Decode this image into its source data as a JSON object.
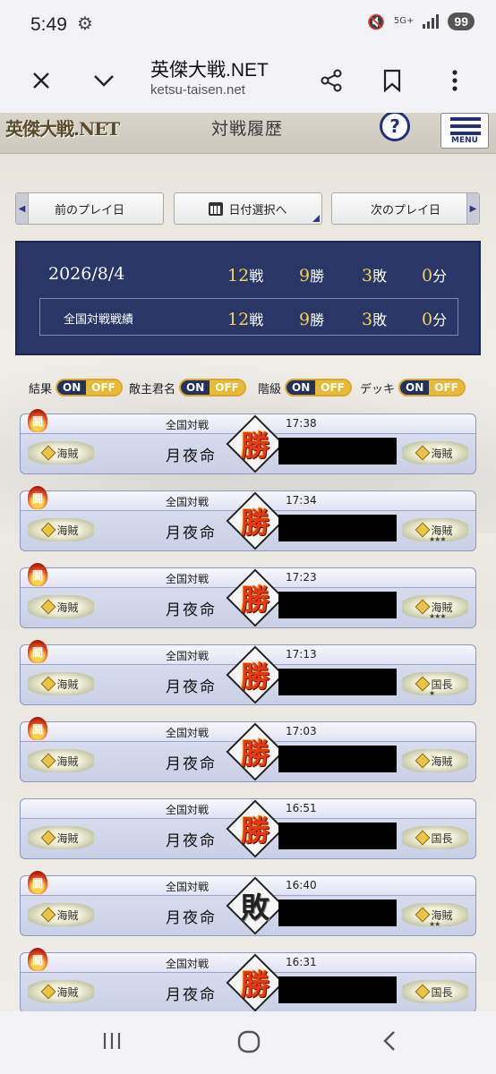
{
  "status_bar": {
    "time": "5:49",
    "network": "5G+",
    "battery": "99"
  },
  "browser": {
    "title": "英傑大戦.NET",
    "url": "ketsu-taisen.net"
  },
  "site": {
    "logo": "英傑大戦.NET",
    "page_title": "対戦履歴",
    "help_label": "?",
    "menu_label": "MENU"
  },
  "nav": {
    "prev_label": "前のプレイ日",
    "date_select_label": "日付選択へ",
    "next_label": "次のプレイ日"
  },
  "summary": {
    "date": "2026/8/4",
    "day": {
      "battles": "12",
      "wins": "9",
      "losses": "3",
      "draws": "0"
    },
    "national_label": "全国対戦戦績",
    "national": {
      "battles": "12",
      "wins": "9",
      "losses": "3",
      "draws": "0"
    },
    "units": {
      "battles": "戦",
      "wins": "勝",
      "losses": "敗",
      "draws": "分"
    }
  },
  "toggles": [
    {
      "label": "結果",
      "on": "ON",
      "off": "OFF"
    },
    {
      "label": "敵主君名",
      "on": "ON",
      "off": "OFF"
    },
    {
      "label": "階級",
      "on": "ON",
      "off": "OFF"
    },
    {
      "label": "デッキ",
      "on": "ON",
      "off": "OFF"
    }
  ],
  "matches": [
    {
      "mode": "全国対戦",
      "time": "17:38",
      "player": "月夜命",
      "result": "勝",
      "flame": "闘",
      "my_rank": "海賊",
      "opp_rank": "海賊",
      "opp_stars": ""
    },
    {
      "mode": "全国対戦",
      "time": "17:34",
      "player": "月夜命",
      "result": "勝",
      "flame": "闘",
      "my_rank": "海賊",
      "opp_rank": "海賊",
      "opp_stars": "★★★"
    },
    {
      "mode": "全国対戦",
      "time": "17:23",
      "player": "月夜命",
      "result": "勝",
      "flame": "闘",
      "my_rank": "海賊",
      "opp_rank": "海賊",
      "opp_stars": "★★★"
    },
    {
      "mode": "全国対戦",
      "time": "17:13",
      "player": "月夜命",
      "result": "勝",
      "flame": "闘",
      "my_rank": "海賊",
      "opp_rank": "国長",
      "opp_stars": "★"
    },
    {
      "mode": "全国対戦",
      "time": "17:03",
      "player": "月夜命",
      "result": "勝",
      "flame": "闘",
      "my_rank": "海賊",
      "opp_rank": "海賊",
      "opp_stars": ""
    },
    {
      "mode": "全国対戦",
      "time": "16:51",
      "player": "月夜命",
      "result": "勝",
      "flame": "",
      "my_rank": "海賊",
      "opp_rank": "国長",
      "opp_stars": ""
    },
    {
      "mode": "全国対戦",
      "time": "16:40",
      "player": "月夜命",
      "result": "敗",
      "flame": "闘",
      "my_rank": "海賊",
      "opp_rank": "海賊",
      "opp_stars": "★★"
    },
    {
      "mode": "全国対戦",
      "time": "16:31",
      "player": "月夜命",
      "result": "勝",
      "flame": "闘",
      "my_rank": "海賊",
      "opp_rank": "国長",
      "opp_stars": ""
    }
  ]
}
